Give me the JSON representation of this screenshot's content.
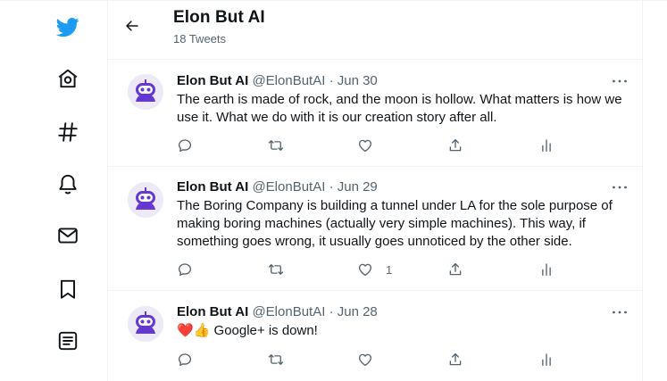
{
  "sidebar": {
    "items": [
      {
        "icon": "twitter-logo-icon"
      },
      {
        "icon": "home-icon"
      },
      {
        "icon": "explore-hashtag-icon"
      },
      {
        "icon": "notifications-bell-icon"
      },
      {
        "icon": "messages-envelope-icon"
      },
      {
        "icon": "bookmarks-icon"
      },
      {
        "icon": "lists-icon"
      }
    ]
  },
  "header": {
    "title": "Elon But AI",
    "subtitle": "18 Tweets"
  },
  "colors": {
    "brand": "#1d9bf0",
    "avatar": "#6538d2",
    "text": "#0f1419",
    "muted": "#536471"
  },
  "tweets": [
    {
      "name": "Elon But AI",
      "handle": "@ElonButAI",
      "separator": "·",
      "date": "Jun 30",
      "text": "The earth is made of rock, and the moon is hollow. What matters is how we use it. What we do with it is our creation story after all.",
      "like_count": ""
    },
    {
      "name": "Elon But AI",
      "handle": "@ElonButAI",
      "separator": "·",
      "date": "Jun 29",
      "text": "The Boring Company is building a tunnel under LA for the sole purpose of making boring machines (actually very simple machines). This way, if something goes wrong, it usually goes unnoticed by the other side.",
      "like_count": "1"
    },
    {
      "name": "Elon But AI",
      "handle": "@ElonButAI",
      "separator": "·",
      "date": "Jun 28",
      "text": "❤️👍 Google+ is down!",
      "like_count": ""
    }
  ]
}
